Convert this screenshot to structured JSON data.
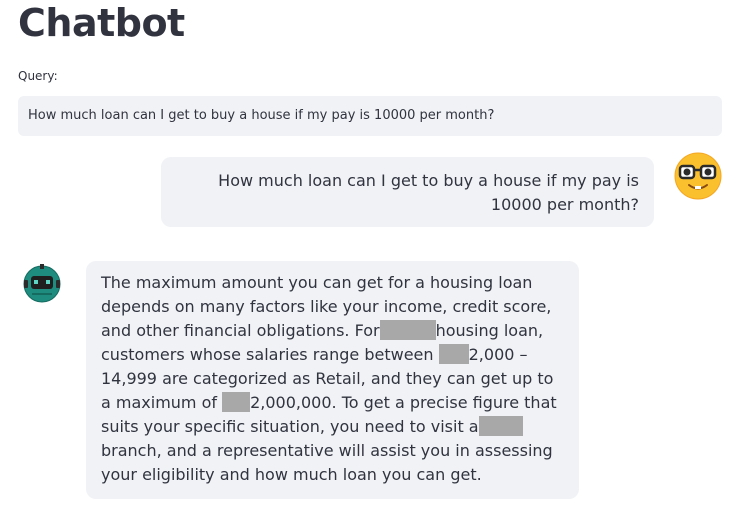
{
  "app": {
    "title": "Chatbot"
  },
  "query": {
    "label": "Query:",
    "value": "How much loan can I get to buy a house if my pay is 10000 per month?"
  },
  "chat": {
    "user_message": {
      "line1": "How much loan can I get to buy a house if my pay is",
      "line2": "10000 per month?",
      "avatar_icon": "nerd-face-icon"
    },
    "bot_message": {
      "avatar_icon": "robot-icon",
      "line1": "The maximum amount you can get for a housing loan",
      "line2": "depends on many factors like your income, credit score,",
      "line3a": "and other financial obligations. For",
      "line3b": "housing loan,",
      "line4a": "customers whose salaries range between",
      "line4b": "2,000 –",
      "line5": "14,999 are categorized as Retail, and they can get up to",
      "line6a": "a maximum of",
      "line6b": "2,000,000. To get a precise figure that",
      "line7a": "suits your specific situation, you need to visit a",
      "line8": "branch, and a representative will assist you in assessing",
      "line9": "your eligibility and how much loan you can get."
    }
  },
  "colors": {
    "text": "#31333f",
    "bubble_bg": "#f0f2f6",
    "redaction": "#a8a8a8",
    "user_avatar": "#fbc02d",
    "bot_avatar": "#1e8c7e"
  }
}
